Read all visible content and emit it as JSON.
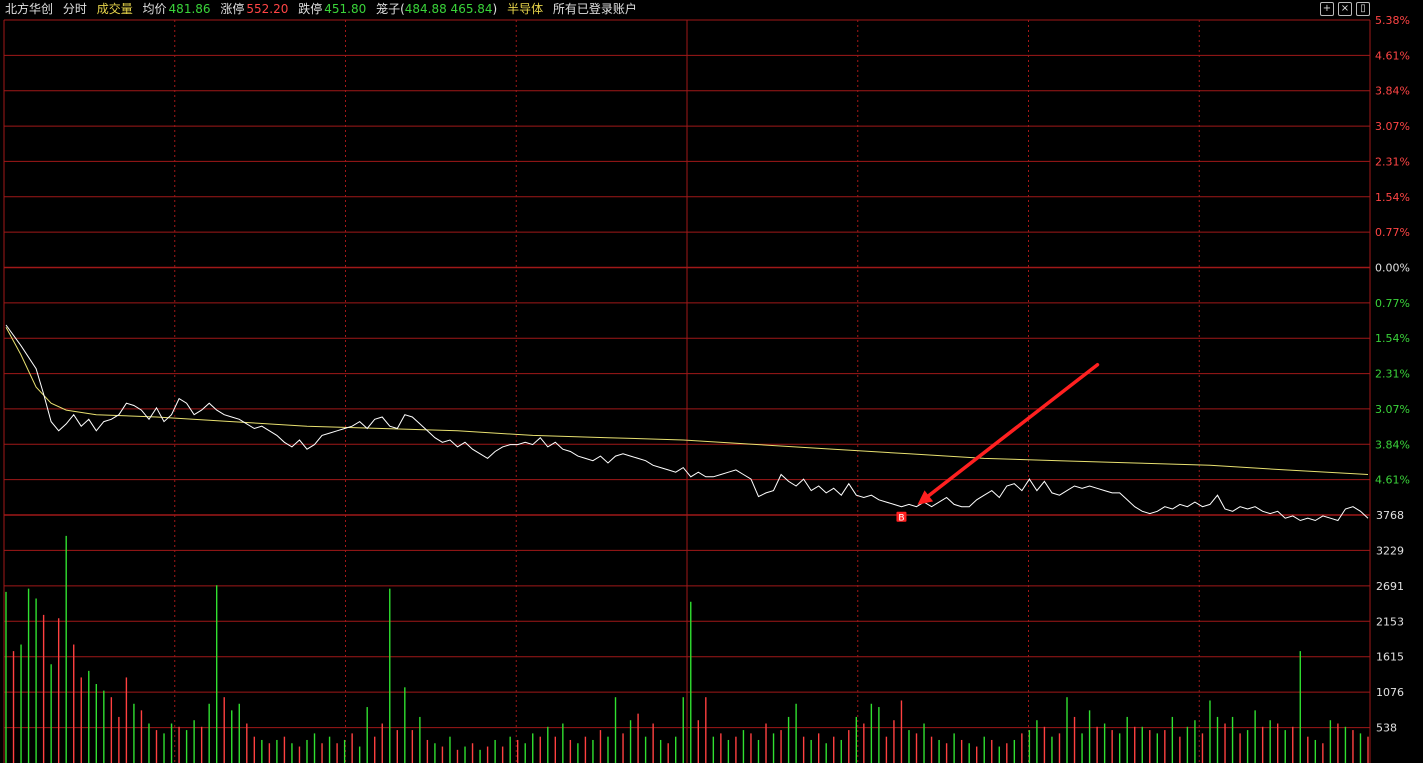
{
  "header": {
    "stock_name": "北方华创",
    "tab_timeshare": "分时",
    "tab_volume": "成交量",
    "avg_label": "均价",
    "avg_value": "481.86",
    "up_limit_label": "涨停",
    "up_limit_value": "552.20",
    "down_limit_label": "跌停",
    "down_limit_value": "451.80",
    "cage_label": "笼子(",
    "cage_value": "484.88 465.84",
    "cage_close": ")",
    "sector": "半导体",
    "accounts": "所有已登录账户"
  },
  "colors": {
    "background": "#000000",
    "grid": "#a01818",
    "price_line": "#ffffff",
    "avg_line": "#e8e070",
    "up_text": "#ff4545",
    "down_text": "#3ad43a",
    "up_bar": "#ff4040",
    "down_bar": "#30e030",
    "arrow": "#ff2020"
  },
  "chart_data": {
    "type": "line",
    "price_axis_labels": [
      "5.38%",
      "4.61%",
      "3.84%",
      "3.07%",
      "2.31%",
      "1.54%",
      "0.77%",
      "0.00%",
      "0.77%",
      "1.54%",
      "2.31%",
      "3.07%",
      "3.84%",
      "4.61%"
    ],
    "volume_axis_labels": [
      "3768",
      "3229",
      "2691",
      "2153",
      "1615",
      "1076",
      "538"
    ],
    "price_pct_range": [
      -5.38,
      5.38
    ],
    "volume_range": [
      0,
      3768
    ],
    "price_pct_series": [
      [
        0,
        -1.25
      ],
      [
        2,
        -1.7
      ],
      [
        4,
        -2.2
      ],
      [
        5,
        -2.75
      ],
      [
        6,
        -3.35
      ],
      [
        7,
        -3.55
      ],
      [
        8,
        -3.4
      ],
      [
        9,
        -3.2
      ],
      [
        10,
        -3.45
      ],
      [
        11,
        -3.3
      ],
      [
        12,
        -3.55
      ],
      [
        13,
        -3.35
      ],
      [
        14,
        -3.3
      ],
      [
        15,
        -3.2
      ],
      [
        16,
        -2.95
      ],
      [
        17,
        -3.0
      ],
      [
        18,
        -3.1
      ],
      [
        19,
        -3.3
      ],
      [
        20,
        -3.05
      ],
      [
        21,
        -3.35
      ],
      [
        22,
        -3.2
      ],
      [
        23,
        -2.85
      ],
      [
        24,
        -2.95
      ],
      [
        25,
        -3.2
      ],
      [
        26,
        -3.1
      ],
      [
        27,
        -2.95
      ],
      [
        28,
        -3.1
      ],
      [
        29,
        -3.2
      ],
      [
        30,
        -3.25
      ],
      [
        31,
        -3.3
      ],
      [
        32,
        -3.4
      ],
      [
        33,
        -3.5
      ],
      [
        34,
        -3.45
      ],
      [
        35,
        -3.55
      ],
      [
        36,
        -3.65
      ],
      [
        37,
        -3.8
      ],
      [
        38,
        -3.9
      ],
      [
        39,
        -3.75
      ],
      [
        40,
        -3.95
      ],
      [
        41,
        -3.85
      ],
      [
        42,
        -3.65
      ],
      [
        43,
        -3.6
      ],
      [
        44,
        -3.55
      ],
      [
        45,
        -3.5
      ],
      [
        46,
        -3.45
      ],
      [
        47,
        -3.35
      ],
      [
        48,
        -3.5
      ],
      [
        49,
        -3.3
      ],
      [
        50,
        -3.25
      ],
      [
        51,
        -3.45
      ],
      [
        52,
        -3.5
      ],
      [
        53,
        -3.2
      ],
      [
        54,
        -3.25
      ],
      [
        55,
        -3.4
      ],
      [
        56,
        -3.55
      ],
      [
        57,
        -3.7
      ],
      [
        58,
        -3.8
      ],
      [
        59,
        -3.75
      ],
      [
        60,
        -3.9
      ],
      [
        61,
        -3.8
      ],
      [
        62,
        -3.95
      ],
      [
        63,
        -4.05
      ],
      [
        64,
        -4.15
      ],
      [
        65,
        -4.0
      ],
      [
        66,
        -3.9
      ],
      [
        67,
        -3.85
      ],
      [
        68,
        -3.85
      ],
      [
        69,
        -3.8
      ],
      [
        70,
        -3.85
      ],
      [
        71,
        -3.7
      ],
      [
        72,
        -3.9
      ],
      [
        73,
        -3.8
      ],
      [
        74,
        -3.95
      ],
      [
        75,
        -4.0
      ],
      [
        76,
        -4.1
      ],
      [
        77,
        -4.15
      ],
      [
        78,
        -4.2
      ],
      [
        79,
        -4.1
      ],
      [
        80,
        -4.25
      ],
      [
        81,
        -4.1
      ],
      [
        82,
        -4.05
      ],
      [
        83,
        -4.1
      ],
      [
        84,
        -4.15
      ],
      [
        85,
        -4.2
      ],
      [
        86,
        -4.3
      ],
      [
        87,
        -4.35
      ],
      [
        88,
        -4.4
      ],
      [
        89,
        -4.45
      ],
      [
        90,
        -4.35
      ],
      [
        91,
        -4.55
      ],
      [
        92,
        -4.45
      ],
      [
        93,
        -4.55
      ],
      [
        94,
        -4.55
      ],
      [
        95,
        -4.5
      ],
      [
        96,
        -4.45
      ],
      [
        97,
        -4.4
      ],
      [
        98,
        -4.5
      ],
      [
        99,
        -4.6
      ],
      [
        100,
        -4.98
      ],
      [
        101,
        -4.9
      ],
      [
        102,
        -4.85
      ],
      [
        103,
        -4.5
      ],
      [
        104,
        -4.65
      ],
      [
        105,
        -4.75
      ],
      [
        106,
        -4.6
      ],
      [
        107,
        -4.85
      ],
      [
        108,
        -4.75
      ],
      [
        109,
        -4.9
      ],
      [
        110,
        -4.8
      ],
      [
        111,
        -4.95
      ],
      [
        112,
        -4.7
      ],
      [
        113,
        -4.95
      ],
      [
        114,
        -5.0
      ],
      [
        115,
        -4.95
      ],
      [
        116,
        -5.05
      ],
      [
        117,
        -5.1
      ],
      [
        118,
        -5.15
      ],
      [
        119,
        -5.2
      ],
      [
        120,
        -5.15
      ],
      [
        121,
        -5.2
      ],
      [
        122,
        -5.1
      ],
      [
        123,
        -5.2
      ],
      [
        124,
        -5.1
      ],
      [
        125,
        -5.0
      ],
      [
        126,
        -5.15
      ],
      [
        127,
        -5.2
      ],
      [
        128,
        -5.2
      ],
      [
        129,
        -5.05
      ],
      [
        130,
        -4.95
      ],
      [
        131,
        -4.85
      ],
      [
        132,
        -5.0
      ],
      [
        133,
        -4.75
      ],
      [
        134,
        -4.7
      ],
      [
        135,
        -4.85
      ],
      [
        136,
        -4.6
      ],
      [
        137,
        -4.85
      ],
      [
        138,
        -4.65
      ],
      [
        139,
        -4.9
      ],
      [
        140,
        -4.95
      ],
      [
        141,
        -4.85
      ],
      [
        142,
        -4.75
      ],
      [
        143,
        -4.8
      ],
      [
        144,
        -4.75
      ],
      [
        145,
        -4.8
      ],
      [
        146,
        -4.85
      ],
      [
        147,
        -4.9
      ],
      [
        148,
        -4.9
      ],
      [
        149,
        -5.05
      ],
      [
        150,
        -5.2
      ],
      [
        151,
        -5.3
      ],
      [
        152,
        -5.35
      ],
      [
        153,
        -5.3
      ],
      [
        154,
        -5.2
      ],
      [
        155,
        -5.25
      ],
      [
        156,
        -5.15
      ],
      [
        157,
        -5.2
      ],
      [
        158,
        -5.1
      ],
      [
        159,
        -5.2
      ],
      [
        160,
        -5.15
      ],
      [
        161,
        -4.95
      ],
      [
        162,
        -5.25
      ],
      [
        163,
        -5.3
      ],
      [
        164,
        -5.2
      ],
      [
        165,
        -5.25
      ],
      [
        166,
        -5.2
      ],
      [
        167,
        -5.3
      ],
      [
        168,
        -5.35
      ],
      [
        169,
        -5.3
      ],
      [
        170,
        -5.45
      ],
      [
        171,
        -5.4
      ],
      [
        172,
        -5.5
      ],
      [
        173,
        -5.45
      ],
      [
        174,
        -5.5
      ],
      [
        175,
        -5.4
      ],
      [
        176,
        -5.45
      ],
      [
        177,
        -5.5
      ],
      [
        178,
        -5.25
      ],
      [
        179,
        -5.2
      ],
      [
        180,
        -5.3
      ],
      [
        181,
        -5.45
      ]
    ],
    "avg_pct_series": [
      [
        0,
        -1.3
      ],
      [
        2,
        -1.9
      ],
      [
        4,
        -2.6
      ],
      [
        6,
        -2.95
      ],
      [
        8,
        -3.1
      ],
      [
        12,
        -3.2
      ],
      [
        20,
        -3.25
      ],
      [
        30,
        -3.35
      ],
      [
        40,
        -3.45
      ],
      [
        50,
        -3.5
      ],
      [
        60,
        -3.55
      ],
      [
        70,
        -3.65
      ],
      [
        80,
        -3.7
      ],
      [
        90,
        -3.75
      ],
      [
        100,
        -3.85
      ],
      [
        110,
        -3.95
      ],
      [
        120,
        -4.05
      ],
      [
        130,
        -4.15
      ],
      [
        140,
        -4.2
      ],
      [
        150,
        -4.25
      ],
      [
        160,
        -4.3
      ],
      [
        170,
        -4.4
      ],
      [
        181,
        -4.5
      ]
    ],
    "volume_series": [
      [
        0,
        2600,
        0
      ],
      [
        1,
        1700,
        1
      ],
      [
        2,
        1800,
        0
      ],
      [
        3,
        2650,
        0
      ],
      [
        4,
        2500,
        0
      ],
      [
        5,
        2250,
        1
      ],
      [
        6,
        1500,
        0
      ],
      [
        7,
        2200,
        1
      ],
      [
        8,
        3450,
        0
      ],
      [
        9,
        1800,
        1
      ],
      [
        10,
        1300,
        1
      ],
      [
        11,
        1400,
        0
      ],
      [
        12,
        1200,
        0
      ],
      [
        13,
        1100,
        0
      ],
      [
        14,
        1000,
        1
      ],
      [
        15,
        700,
        1
      ],
      [
        16,
        1300,
        1
      ],
      [
        17,
        900,
        0
      ],
      [
        18,
        800,
        1
      ],
      [
        19,
        600,
        0
      ],
      [
        20,
        500,
        1
      ],
      [
        21,
        450,
        0
      ],
      [
        22,
        600,
        0
      ],
      [
        23,
        550,
        1
      ],
      [
        24,
        500,
        0
      ],
      [
        25,
        650,
        0
      ],
      [
        26,
        550,
        1
      ],
      [
        27,
        900,
        0
      ],
      [
        28,
        2700,
        0
      ],
      [
        29,
        1000,
        1
      ],
      [
        30,
        800,
        0
      ],
      [
        31,
        900,
        0
      ],
      [
        32,
        600,
        1
      ],
      [
        33,
        400,
        1
      ],
      [
        34,
        350,
        0
      ],
      [
        35,
        300,
        1
      ],
      [
        36,
        350,
        0
      ],
      [
        37,
        400,
        1
      ],
      [
        38,
        300,
        0
      ],
      [
        39,
        250,
        1
      ],
      [
        40,
        350,
        0
      ],
      [
        41,
        450,
        0
      ],
      [
        42,
        300,
        1
      ],
      [
        43,
        400,
        0
      ],
      [
        44,
        300,
        1
      ],
      [
        45,
        350,
        0
      ],
      [
        46,
        450,
        1
      ],
      [
        47,
        250,
        0
      ],
      [
        48,
        850,
        0
      ],
      [
        49,
        400,
        1
      ],
      [
        50,
        600,
        1
      ],
      [
        51,
        2650,
        0
      ],
      [
        52,
        500,
        1
      ],
      [
        53,
        1150,
        0
      ],
      [
        54,
        500,
        1
      ],
      [
        55,
        700,
        0
      ],
      [
        56,
        350,
        1
      ],
      [
        57,
        300,
        0
      ],
      [
        58,
        250,
        1
      ],
      [
        59,
        400,
        0
      ],
      [
        60,
        200,
        1
      ],
      [
        61,
        250,
        0
      ],
      [
        62,
        300,
        1
      ],
      [
        63,
        200,
        0
      ],
      [
        64,
        250,
        1
      ],
      [
        65,
        350,
        0
      ],
      [
        66,
        250,
        1
      ],
      [
        67,
        400,
        0
      ],
      [
        68,
        350,
        1
      ],
      [
        69,
        300,
        0
      ],
      [
        70,
        450,
        0
      ],
      [
        71,
        400,
        1
      ],
      [
        72,
        550,
        0
      ],
      [
        73,
        400,
        1
      ],
      [
        74,
        600,
        0
      ],
      [
        75,
        350,
        1
      ],
      [
        76,
        300,
        0
      ],
      [
        77,
        400,
        1
      ],
      [
        78,
        350,
        0
      ],
      [
        79,
        500,
        1
      ],
      [
        80,
        400,
        0
      ],
      [
        81,
        1000,
        0
      ],
      [
        82,
        450,
        1
      ],
      [
        83,
        650,
        0
      ],
      [
        84,
        750,
        1
      ],
      [
        85,
        400,
        0
      ],
      [
        86,
        600,
        1
      ],
      [
        87,
        350,
        0
      ],
      [
        88,
        300,
        1
      ],
      [
        89,
        400,
        0
      ],
      [
        90,
        1000,
        0
      ],
      [
        91,
        2450,
        0
      ],
      [
        92,
        650,
        1
      ],
      [
        93,
        1000,
        1
      ],
      [
        94,
        400,
        0
      ],
      [
        95,
        450,
        1
      ],
      [
        96,
        350,
        0
      ],
      [
        97,
        400,
        1
      ],
      [
        98,
        500,
        0
      ],
      [
        99,
        450,
        1
      ],
      [
        100,
        350,
        0
      ],
      [
        101,
        600,
        1
      ],
      [
        102,
        450,
        0
      ],
      [
        103,
        500,
        1
      ],
      [
        104,
        700,
        0
      ],
      [
        105,
        900,
        0
      ],
      [
        106,
        400,
        1
      ],
      [
        107,
        350,
        0
      ],
      [
        108,
        450,
        1
      ],
      [
        109,
        300,
        0
      ],
      [
        110,
        400,
        1
      ],
      [
        111,
        350,
        0
      ],
      [
        112,
        500,
        1
      ],
      [
        113,
        700,
        0
      ],
      [
        114,
        600,
        1
      ],
      [
        115,
        900,
        0
      ],
      [
        116,
        850,
        0
      ],
      [
        117,
        400,
        1
      ],
      [
        118,
        650,
        1
      ],
      [
        119,
        950,
        1
      ],
      [
        120,
        500,
        0
      ],
      [
        121,
        450,
        1
      ],
      [
        122,
        600,
        0
      ],
      [
        123,
        400,
        1
      ],
      [
        124,
        350,
        0
      ],
      [
        125,
        300,
        1
      ],
      [
        126,
        450,
        0
      ],
      [
        127,
        350,
        1
      ],
      [
        128,
        300,
        0
      ],
      [
        129,
        250,
        1
      ],
      [
        130,
        400,
        0
      ],
      [
        131,
        350,
        1
      ],
      [
        132,
        250,
        0
      ],
      [
        133,
        300,
        1
      ],
      [
        134,
        350,
        0
      ],
      [
        135,
        450,
        1
      ],
      [
        136,
        500,
        0
      ],
      [
        137,
        650,
        0
      ],
      [
        138,
        550,
        1
      ],
      [
        139,
        400,
        0
      ],
      [
        140,
        450,
        1
      ],
      [
        141,
        1000,
        0
      ],
      [
        142,
        700,
        1
      ],
      [
        143,
        450,
        0
      ],
      [
        144,
        800,
        0
      ],
      [
        145,
        550,
        1
      ],
      [
        146,
        600,
        0
      ],
      [
        147,
        500,
        1
      ],
      [
        148,
        450,
        0
      ],
      [
        149,
        700,
        0
      ],
      [
        150,
        550,
        1
      ],
      [
        151,
        550,
        0
      ],
      [
        152,
        500,
        1
      ],
      [
        153,
        450,
        0
      ],
      [
        154,
        500,
        1
      ],
      [
        155,
        700,
        0
      ],
      [
        156,
        400,
        1
      ],
      [
        157,
        550,
        0
      ],
      [
        158,
        650,
        0
      ],
      [
        159,
        450,
        1
      ],
      [
        160,
        950,
        0
      ],
      [
        161,
        700,
        0
      ],
      [
        162,
        600,
        1
      ],
      [
        163,
        700,
        0
      ],
      [
        164,
        450,
        1
      ],
      [
        165,
        500,
        0
      ],
      [
        166,
        800,
        0
      ],
      [
        167,
        550,
        1
      ],
      [
        168,
        650,
        0
      ],
      [
        169,
        600,
        1
      ],
      [
        170,
        500,
        0
      ],
      [
        171,
        550,
        1
      ],
      [
        172,
        1700,
        0
      ],
      [
        173,
        400,
        1
      ],
      [
        174,
        350,
        0
      ],
      [
        175,
        300,
        1
      ],
      [
        176,
        650,
        0
      ],
      [
        177,
        600,
        1
      ],
      [
        178,
        550,
        0
      ],
      [
        179,
        500,
        1
      ],
      [
        180,
        450,
        0
      ],
      [
        181,
        400,
        1
      ]
    ],
    "signal_marker": {
      "label": "B",
      "index": 119
    }
  }
}
